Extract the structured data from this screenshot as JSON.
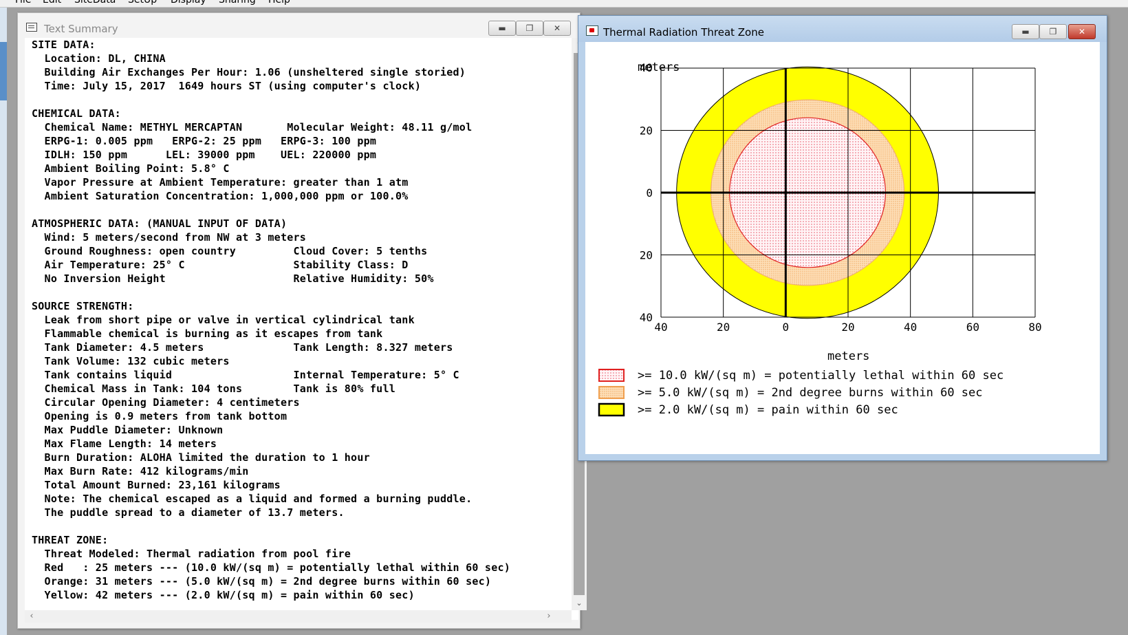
{
  "menubar": {
    "items": [
      "File",
      "Edit",
      "SiteData",
      "SetUp",
      "Display",
      "Sharing",
      "Help"
    ]
  },
  "text_window": {
    "title": "Text Summary",
    "lines": [
      "SITE DATA:",
      "  Location: DL, CHINA",
      "  Building Air Exchanges Per Hour: 1.06 (unsheltered single storied)",
      "  Time: July 15, 2017  1649 hours ST (using computer's clock)",
      "",
      "CHEMICAL DATA:",
      "  Chemical Name: METHYL MERCAPTAN       Molecular Weight: 48.11 g/mol",
      "  ERPG-1: 0.005 ppm   ERPG-2: 25 ppm   ERPG-3: 100 ppm",
      "  IDLH: 150 ppm      LEL: 39000 ppm    UEL: 220000 ppm",
      "  Ambient Boiling Point: 5.8° C",
      "  Vapor Pressure at Ambient Temperature: greater than 1 atm",
      "  Ambient Saturation Concentration: 1,000,000 ppm or 100.0%",
      "",
      "ATMOSPHERIC DATA: (MANUAL INPUT OF DATA)",
      "  Wind: 5 meters/second from NW at 3 meters",
      "  Ground Roughness: open country         Cloud Cover: 5 tenths",
      "  Air Temperature: 25° C                 Stability Class: D",
      "  No Inversion Height                    Relative Humidity: 50%",
      "",
      "SOURCE STRENGTH:",
      "  Leak from short pipe or valve in vertical cylindrical tank",
      "  Flammable chemical is burning as it escapes from tank",
      "  Tank Diameter: 4.5 meters              Tank Length: 8.327 meters",
      "  Tank Volume: 132 cubic meters",
      "  Tank contains liquid                   Internal Temperature: 5° C",
      "  Chemical Mass in Tank: 104 tons        Tank is 80% full",
      "  Circular Opening Diameter: 4 centimeters",
      "  Opening is 0.9 meters from tank bottom",
      "  Max Puddle Diameter: Unknown",
      "  Max Flame Length: 14 meters",
      "  Burn Duration: ALOHA limited the duration to 1 hour",
      "  Max Burn Rate: 412 kilograms/min",
      "  Total Amount Burned: 23,161 kilograms",
      "  Note: The chemical escaped as a liquid and formed a burning puddle.",
      "  The puddle spread to a diameter of 13.7 meters.",
      "",
      "THREAT ZONE:",
      "  Threat Modeled: Thermal radiation from pool fire",
      "  Red   : 25 meters --- (10.0 kW/(sq m) = potentially lethal within 60 sec)",
      "  Orange: 31 meters --- (5.0 kW/(sq m) = 2nd degree burns within 60 sec)",
      "  Yellow: 42 meters --- (2.0 kW/(sq m) = pain within 60 sec)"
    ]
  },
  "thermal_window": {
    "title": "Thermal Radiation Threat Zone",
    "y_unit_label": "meters",
    "x_unit_label": "meters",
    "y_ticks": [
      "40",
      "20",
      "0",
      "20",
      "40"
    ],
    "x_ticks": [
      "40",
      "20",
      "0",
      "20",
      "40",
      "60",
      "80"
    ],
    "legend": [
      {
        "label": ">= 10.0 kW/(sq m) = potentially lethal within 60 sec",
        "fill": "#fde8ec",
        "border": "#e02020"
      },
      {
        "label": ">= 5.0 kW/(sq m) = 2nd degree burns within 60 sec",
        "fill": "#fcd6a8",
        "border": "#f0a050"
      },
      {
        "label": ">= 2.0 kW/(sq m) = pain within 60 sec",
        "fill": "#ffff00",
        "border": "#000000"
      }
    ],
    "zones": [
      {
        "name": "yellow",
        "radius_m": 42,
        "fill": "#ffff00",
        "stroke": "#000000"
      },
      {
        "name": "orange",
        "radius_m": 31,
        "fill": "#fcd6a8",
        "stroke": "#f0b070"
      },
      {
        "name": "red",
        "radius_m": 25,
        "fill": "#fde8ec",
        "stroke": "#e02020"
      }
    ],
    "source_offset_m": [
      7,
      0
    ]
  }
}
